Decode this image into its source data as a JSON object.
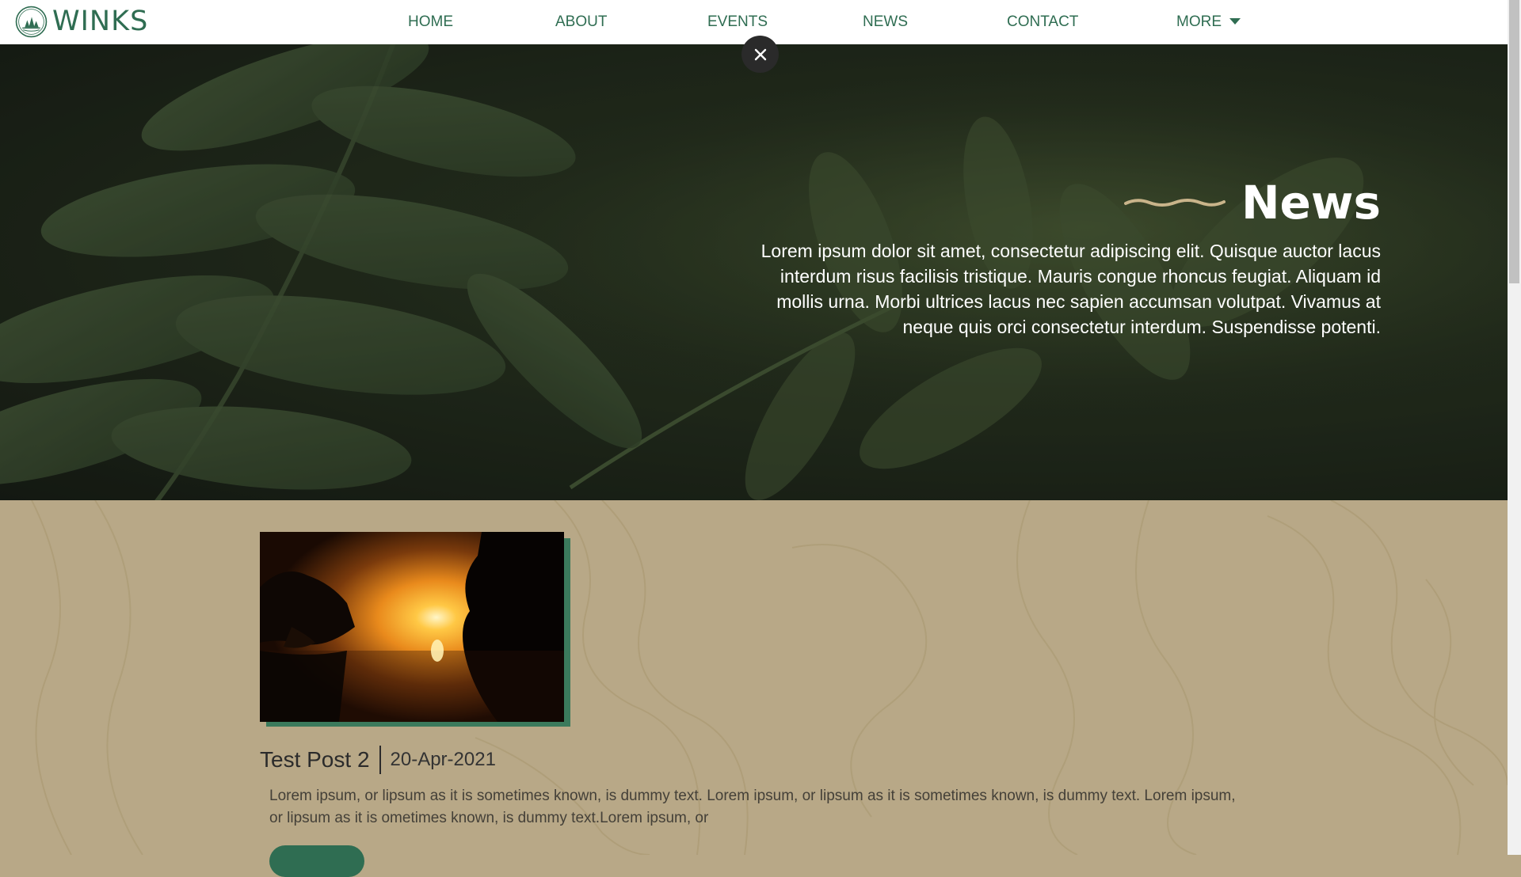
{
  "brand": {
    "name": "WINKS",
    "logo_icon": "trees-emblem-icon"
  },
  "nav": {
    "items": [
      {
        "label": "HOME"
      },
      {
        "label": "ABOUT"
      },
      {
        "label": "EVENTS"
      },
      {
        "label": "NEWS"
      },
      {
        "label": "CONTACT"
      },
      {
        "label": "MORE"
      }
    ],
    "more_icon": "caret-down-icon"
  },
  "overlay": {
    "close_icon": "close-icon"
  },
  "hero": {
    "title": "News",
    "description": "Lorem ipsum dolor sit amet, consectetur adipiscing elit. Quisque auctor lacus interdum risus facilisis tristique. Mauris congue rhoncus feugiat. Aliquam id mollis urna. Morbi ultrices lacus nec sapien accumsan volutpat. Vivamus at neque quis orci consectetur interdum. Suspendisse potenti.",
    "decor_icon": "wave-line-icon"
  },
  "posts": [
    {
      "title": "Test Post 2",
      "date": "20-Apr-2021",
      "excerpt": "Lorem ipsum, or lipsum as it is sometimes known, is dummy text. Lorem ipsum, or lipsum as it is sometimes known, is dummy text. Lorem ipsum, or lipsum as it is ometimes known, is dummy text.Lorem ipsum, or"
    }
  ],
  "colors": {
    "brand_green": "#2f6d52",
    "sand_background": "#b8a887",
    "nav_background": "#ffffff",
    "hero_accent_wave": "#c9b48a",
    "image_shadow": "#3b7a5c"
  }
}
